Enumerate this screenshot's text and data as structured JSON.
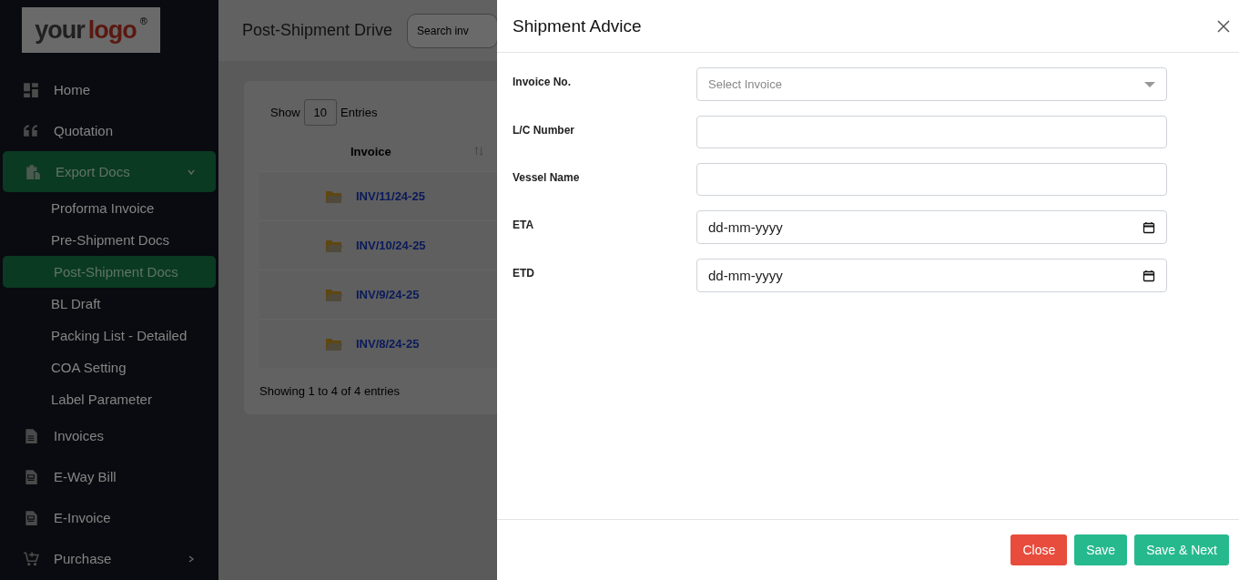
{
  "sidebar": {
    "logo": {
      "first": "your",
      "second": "logo",
      "mark": "®"
    },
    "items": [
      {
        "label": "Home",
        "selected": false
      },
      {
        "label": "Quotation",
        "selected": false
      },
      {
        "label": "Export Docs",
        "selected": true,
        "expanded": true,
        "children": [
          {
            "label": "Proforma Invoice",
            "selected": false
          },
          {
            "label": "Pre-Shipment Docs",
            "selected": false
          },
          {
            "label": "Post-Shipment Docs",
            "selected": true
          },
          {
            "label": "BL Draft",
            "selected": false
          },
          {
            "label": "Packing List - Detailed",
            "selected": false
          },
          {
            "label": "COA Setting",
            "selected": false
          },
          {
            "label": "Label Parameter",
            "selected": false
          }
        ]
      },
      {
        "label": "Invoices",
        "selected": false
      },
      {
        "label": "E-Way Bill",
        "selected": false
      },
      {
        "label": "E-Invoice",
        "selected": false
      },
      {
        "label": "Purchase",
        "selected": false,
        "expanded": false
      }
    ]
  },
  "header": {
    "title": "Post-Shipment Drive",
    "search": {
      "placeholder": "Search inv"
    }
  },
  "table": {
    "show_label": "Show",
    "page_size": "10",
    "entries_label": "Entries",
    "columns": [
      "Invoice"
    ],
    "rows": [
      {
        "invoice": "INV/11/24-25"
      },
      {
        "invoice": "INV/10/24-25"
      },
      {
        "invoice": "INV/9/24-25"
      },
      {
        "invoice": "INV/8/24-25"
      }
    ],
    "footer": "Showing 1 to 4 of 4 entries"
  },
  "modal": {
    "title": "Shipment Advice",
    "fields": [
      {
        "label": "Invoice No.",
        "kind": "select",
        "placeholder": "Select Invoice"
      },
      {
        "label": "L/C Number",
        "kind": "text"
      },
      {
        "label": "Vessel Name",
        "kind": "text"
      },
      {
        "label": "ETA",
        "kind": "date",
        "placeholder": "dd-mm-yyyy"
      },
      {
        "label": "ETD",
        "kind": "date",
        "placeholder": "dd-mm-yyyy"
      }
    ],
    "buttons": [
      {
        "label": "Close",
        "kind": "danger"
      },
      {
        "label": "Save",
        "kind": "primary"
      },
      {
        "label": "Save & Next",
        "kind": "primary"
      }
    ]
  }
}
